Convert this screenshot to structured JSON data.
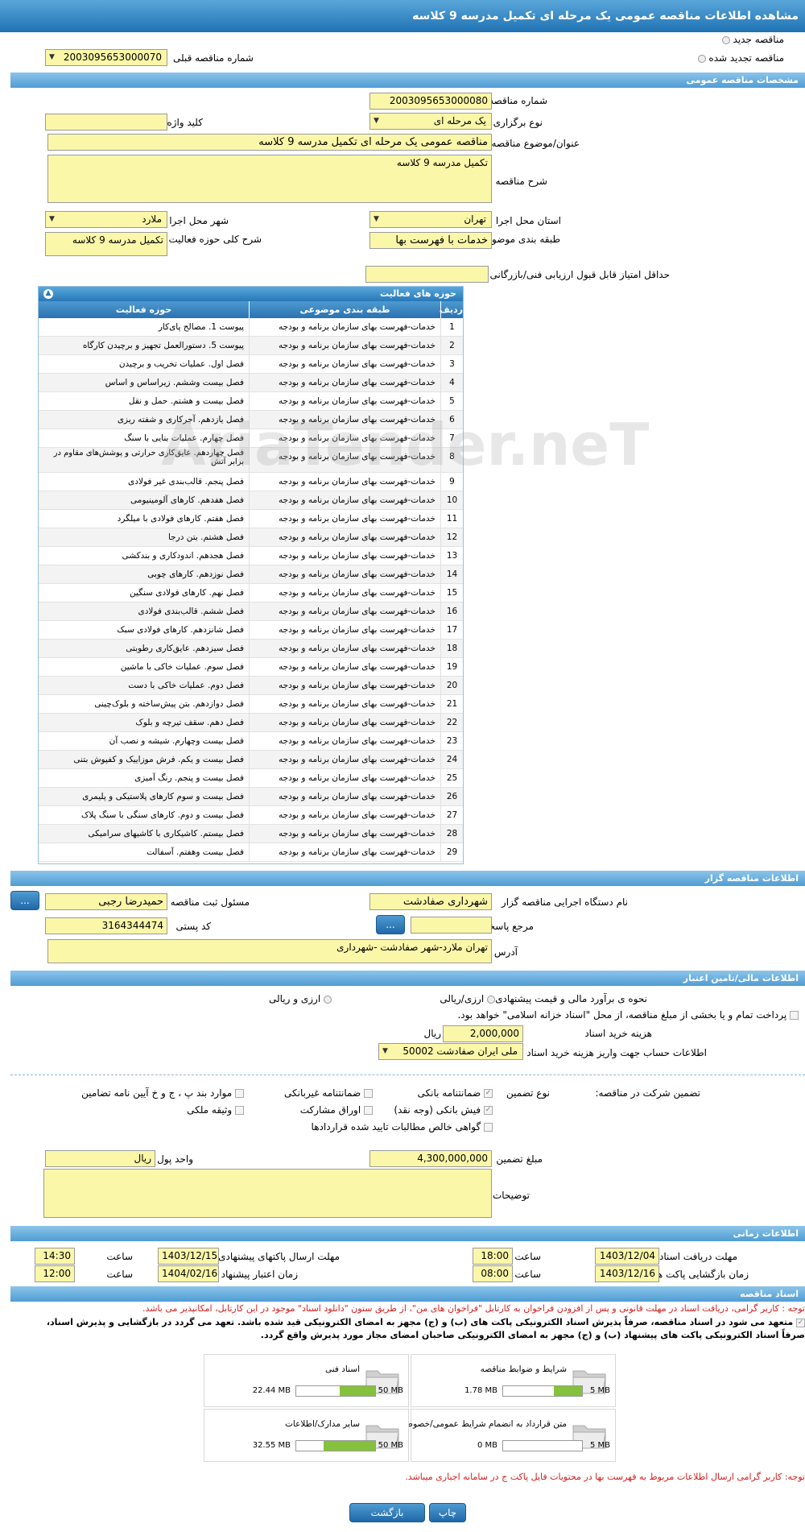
{
  "page": {
    "title": "مشاهده اطلاعات مناقصه عمومی یک مرحله ای تکمیل مدرسه 9 کلاسه"
  },
  "top": {
    "radio_new": "مناقصه جدید",
    "radio_renewed": "مناقصه تجدید شده",
    "prev_label": "شماره مناقصه قبلی",
    "prev_value": "2003095653000070"
  },
  "general": {
    "section": "مشخصات مناقصه عمومی",
    "number_label": "شماره مناقصه",
    "number_value": "2003095653000080",
    "type_label": "نوع برگزاری",
    "type_value": "یک مرحله ای",
    "keyword_label": "کلید واژه",
    "keyword_value": "",
    "subject_label": "عنوان/موضوع مناقصه",
    "subject_value": "مناقصه عمومی یک مرحله ای تکمیل مدرسه 9 کلاسه",
    "desc_label": "شرح مناقصه",
    "desc_value": "تکمیل مدرسه 9 کلاسه",
    "province_label": "استان محل اجرا",
    "province_value": "تهران",
    "city_label": "شهر محل اجرا",
    "city_value": "ملارد",
    "category_label": "طبقه بندی موضوعی",
    "category_value": "خدمات با فهرست بها",
    "scope_label": "شرح کلی حوزه فعالیت",
    "scope_value": "تکمیل مدرسه 9 کلاسه",
    "min_score_label": "حداقل امتیاز قابل قبول ارزیابی فنی/بازرگانی",
    "min_score_value": ""
  },
  "activities": {
    "title": "حوزه های فعالیت",
    "headers": [
      "ردیف",
      "طبقه بندی موضوعی",
      "حوزه فعالیت"
    ],
    "rows": [
      [
        "1",
        "خدمات-فهرست بهای سازمان برنامه و بودجه",
        "پیوست 1. مصالح پای‌کار"
      ],
      [
        "2",
        "خدمات-فهرست بهای سازمان برنامه و بودجه",
        "پیوست 5. دستورالعمل تجهیز و برچیدن کارگاه"
      ],
      [
        "3",
        "خدمات-فهرست بهای سازمان برنامه و بودجه",
        "فصل اول. عملیات تخریب و برچیدن"
      ],
      [
        "4",
        "خدمات-فهرست بهای سازمان برنامه و بودجه",
        "فصل بیست وششم. زیراساس و اساس"
      ],
      [
        "5",
        "خدمات-فهرست بهای سازمان برنامه و بودجه",
        "فصل بیست و هشتم. حمل و نقل"
      ],
      [
        "6",
        "خدمات-فهرست بهای سازمان برنامه و بودجه",
        "فصل یازدهم. آجرکاری و شفته ریزی"
      ],
      [
        "7",
        "خدمات-فهرست بهای سازمان برنامه و بودجه",
        "فصل چهارم. عملیات بنایی با سنگ"
      ],
      [
        "8",
        "خدمات-فهرست بهای سازمان برنامه و بودجه",
        "فصل چهاردهم. عایق‌کاری حرارتی و پوشش‌های مقاوم در برابر آتش"
      ],
      [
        "9",
        "خدمات-فهرست بهای سازمان برنامه و بودجه",
        "فصل پنجم. قالب‌بندی غیر فولادی"
      ],
      [
        "10",
        "خدمات-فهرست بهای سازمان برنامه و بودجه",
        "فصل هفدهم. کارهای آلومینیومی"
      ],
      [
        "11",
        "خدمات-فهرست بهای سازمان برنامه و بودجه",
        "فصل هفتم. کارهای فولادی با میلگرد"
      ],
      [
        "12",
        "خدمات-فهرست بهای سازمان برنامه و بودجه",
        "فصل هشتم. بتن درجا"
      ],
      [
        "13",
        "خدمات-فهرست بهای سازمان برنامه و بودجه",
        "فصل هجدهم. اندودکاری و بندکشی"
      ],
      [
        "14",
        "خدمات-فهرست بهای سازمان برنامه و بودجه",
        "فصل نوزدهم. کارهای چوبی"
      ],
      [
        "15",
        "خدمات-فهرست بهای سازمان برنامه و بودجه",
        "فصل نهم. کارهای فولادی سنگین"
      ],
      [
        "16",
        "خدمات-فهرست بهای سازمان برنامه و بودجه",
        "فصل ششم. قالب‌بندی فولادی"
      ],
      [
        "17",
        "خدمات-فهرست بهای سازمان برنامه و بودجه",
        "فصل شانزدهم. کارهای فولادی سبک"
      ],
      [
        "18",
        "خدمات-فهرست بهای سازمان برنامه و بودجه",
        "فصل سیزدهم. عایق‌کاری رطوبتی"
      ],
      [
        "19",
        "خدمات-فهرست بهای سازمان برنامه و بودجه",
        "فصل سوم. عملیات خاکی با ماشین"
      ],
      [
        "20",
        "خدمات-فهرست بهای سازمان برنامه و بودجه",
        "فصل دوم. عملیات خاکی با دست"
      ],
      [
        "21",
        "خدمات-فهرست بهای سازمان برنامه و بودجه",
        "فصل دوازدهم. بتن پیش‌ساخته و بلوک‌چینی"
      ],
      [
        "22",
        "خدمات-فهرست بهای سازمان برنامه و بودجه",
        "فصل دهم. سقف تیرچه و بلوک"
      ],
      [
        "23",
        "خدمات-فهرست بهای سازمان برنامه و بودجه",
        "فصل بیست وچهارم. شیشه و نصب آن"
      ],
      [
        "24",
        "خدمات-فهرست بهای سازمان برنامه و بودجه",
        "فصل بیست و یکم. فرش موزاییک و کفپوش بتنی"
      ],
      [
        "25",
        "خدمات-فهرست بهای سازمان برنامه و بودجه",
        "فصل بیست و پنجم. رنگ آمیزی"
      ],
      [
        "26",
        "خدمات-فهرست بهای سازمان برنامه و بودجه",
        "فصل بیست و سوم کارهای پلاستیکی و پلیمری"
      ],
      [
        "27",
        "خدمات-فهرست بهای سازمان برنامه و بودجه",
        "فصل بیست و دوم. کارهای سنگی با سنگ پلاک"
      ],
      [
        "28",
        "خدمات-فهرست بهای سازمان برنامه و بودجه",
        "فصل بیستم. کاشیکاری با کاشیهای سرامیکی"
      ],
      [
        "29",
        "خدمات-فهرست بهای سازمان برنامه و بودجه",
        "فصل بیست وهفتم. آسفالت"
      ]
    ]
  },
  "organizer": {
    "section": "اطلاعات مناقصه گزار",
    "org_label": "نام دستگاه اجرایی مناقصه گزار",
    "org_value": "شهرداری صفادشت",
    "resp_label": "مسئول ثبت مناقصه",
    "resp_value": "حمیدرضا رجبی",
    "ref_label": "مرجع پاسخگویی",
    "ref_value": "",
    "postal_label": "کد پستی",
    "postal_value": "3164344474",
    "address_label": "آدرس",
    "address_value": "تهران ملارد-شهر صفادشت -شهرداری",
    "btn": "..."
  },
  "finance": {
    "section": "اطلاعات مالی/تامین اعتبار",
    "estimate_label": "نحوه ی برآورد مالی و قیمت پیشنهادی",
    "opt1": "ارزی/ریالی",
    "opt2": "ارزی و ریالی",
    "treasury_text": "پرداخت تمام و یا بخشی از مبلغ مناقصه، از محل \"اسناد خزانه اسلامی\" خواهد بود.",
    "doc_cost_label": "هزینه خرید اسناد",
    "doc_cost_value": "2,000,000",
    "currency": "ریال",
    "account_label": "اطلاعات حساب جهت واریز هزینه خرید اسناد",
    "account_value": "ملی ایران صفادشت 50002"
  },
  "guarantee": {
    "label": "تضمین شرکت در مناقصه:",
    "type_label": "نوع تضمین",
    "items": [
      "ضمانتنامه بانکی",
      "ضمانتنامه غیربانکی",
      "موارد بند پ ، ج و خ آیین نامه تضامین",
      "فیش بانکی (وجه نقد)",
      "اوراق مشارکت",
      "وثیقه ملکی",
      "گواهی خالص مطالبات تایید شده قراردادها"
    ],
    "amount_label": "مبلغ تضمین",
    "amount_value": "4,300,000,000",
    "unit_label": "واحد پول",
    "unit_value": "ریال",
    "notes_label": "توضیحات",
    "notes_value": ""
  },
  "timing": {
    "section": "اطلاعات زمانی",
    "receive_label": "مهلت دریافت اسناد",
    "receive_date": "1403/12/04",
    "receive_time": "18:00",
    "send_label": "مهلت ارسال پاکتهای پیشنهادی",
    "send_date": "1403/12/15",
    "send_time": "14:30",
    "open_label": "زمان بازگشایی پاکت ها",
    "open_date": "1403/12/16",
    "open_time": "08:00",
    "valid_label": "زمان اعتبار پیشنهاد",
    "valid_date": "1404/02/16",
    "valid_time": "12:00",
    "time_label": "ساعت"
  },
  "docs": {
    "section": "اسناد مناقصه",
    "notice": "توجه : کاربر گرامی، دریافت اسناد در مهلت قانونی و پس از افزودن فراخوان به کارتابل \"فراخوان های من\"، از طریق ستون \"دانلود اسناد\" موجود در این کارتابل، امکانپذیر می باشد.",
    "commit1": "متعهد می شود در اسناد مناقصه، صرفاً پذیرش اسناد الکترونیکی پاکت های (ب) و (ج) مجهز به امضای الکترونیکی قید شده باشد. تعهد می گردد در بازگشایی و پذیرش اسناد،",
    "commit2": "صرفاً اسناد الکترونیکی پاکت های پیشنهاد (ب) و (ج) مجهز به امضای الکترونیکی صاحبان امضای مجاز مورد پذیرش واقع گردد.",
    "files": [
      {
        "name": "شرایط و ضوابط مناقصه",
        "current": "1.78 MB",
        "max": "5 MB",
        "fraction": 0.36
      },
      {
        "name": "اسناد فنی",
        "current": "22.44 MB",
        "max": "50 MB",
        "fraction": 0.45
      },
      {
        "name": "متن قرارداد به انضمام شرایط عمومی/خصوصی",
        "current": "0 MB",
        "max": "5 MB",
        "fraction": 0
      },
      {
        "name": "سایر مدارک/اطلاعات",
        "current": "32.55 MB",
        "max": "50 MB",
        "fraction": 0.65
      }
    ],
    "footer_note": "توجه: کاربر گرامی ارسال اطلاعات مربوط به فهرست بها در محتویات فایل پاکت ج در سامانه اجباری میباشد."
  },
  "buttons": {
    "print": "چاپ",
    "back": "بازگشت"
  },
  "watermark": "AriaTender.neT"
}
